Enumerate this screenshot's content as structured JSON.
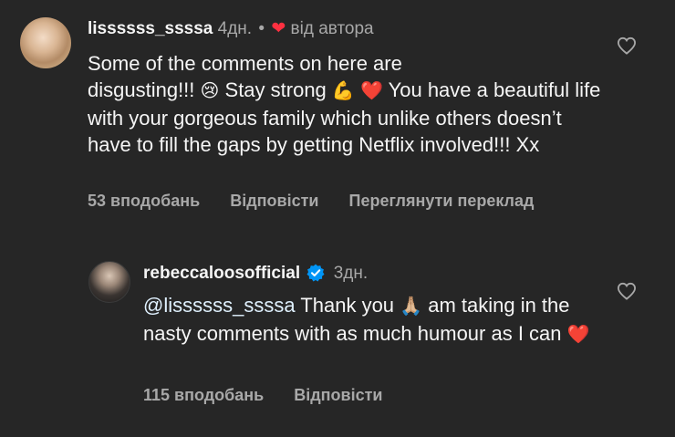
{
  "comment1": {
    "username": "lissssss_ssssa",
    "time": "4дн.",
    "separator": "•",
    "author_heart": "❤",
    "author_label": "від автора",
    "text_line1": "Some of the comments on here are",
    "text_line2a": "disgusting!!!",
    "emoji_cry": "😢",
    "text_line2b": "Stay strong",
    "emoji_muscle": "💪",
    "emoji_heart": "❤️",
    "text_line2c": "You have a",
    "text_rest": "beautiful life with your gorgeous family which unlike others doesn’t have to fill the gaps by getting Netflix involved!!! Xx",
    "likes": "53 вподобань",
    "reply": "Відповісти",
    "translate": "Переглянути переклад"
  },
  "comment2": {
    "username": "rebeccaloosofficial",
    "time": "3дн.",
    "mention": "@lissssss_ssssa",
    "text_a": "Thank you",
    "emoji_pray": "🙏🏼",
    "text_b": "am taking in the nasty comments with as much humour as I can",
    "emoji_heart": "❤️",
    "likes": "115 вподобань",
    "reply": "Відповісти"
  },
  "colors": {
    "background": "#262626",
    "text": "#f5f5f5",
    "secondary": "#a8a8a8",
    "heart": "#ff3040",
    "verified": "#0095f6"
  },
  "icons": [
    "heart-outline-icon",
    "verified-badge-icon"
  ]
}
